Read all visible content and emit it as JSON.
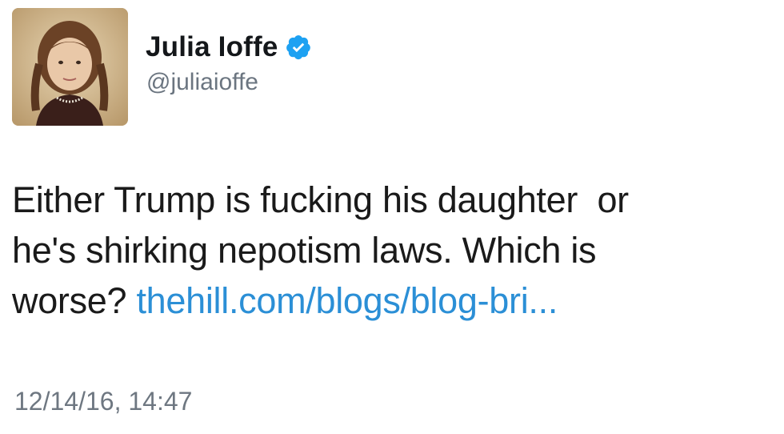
{
  "author": {
    "display_name": "Julia Ioffe",
    "handle": "@juliaioffe",
    "verified": true,
    "avatar_icon": "profile-photo-icon"
  },
  "tweet": {
    "line1": "Either Trump is fucking his daughter  or",
    "line2": "he's shirking nepotism laws. Which is",
    "line3_text": "worse? ",
    "link_text": "thehill.com/blogs/blog-bri..."
  },
  "timestamp": "12/14/16, 14:47",
  "colors": {
    "link": "#2b8fd6",
    "verified_badge": "#1da1f2",
    "handle": "#6b7580",
    "timestamp": "#6e7781"
  }
}
